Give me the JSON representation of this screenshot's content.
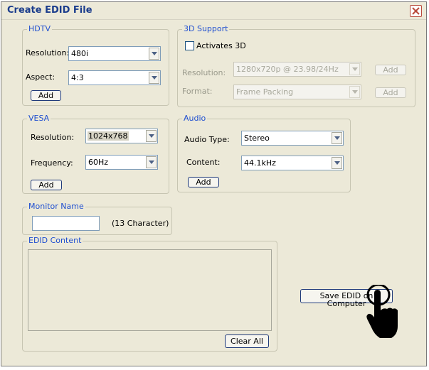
{
  "window": {
    "title": "Create EDID File"
  },
  "hdtv": {
    "legend": "HDTV",
    "resolution_label": "Resolution:",
    "resolution_value": "480i",
    "aspect_label": "Aspect:",
    "aspect_value": "4:3",
    "add_label": "Add"
  },
  "support3d": {
    "legend": "3D Support",
    "activate_label": "Activates 3D",
    "activate_checked": false,
    "resolution_label": "Resolution:",
    "resolution_value": "1280x720p @ 23.98/24Hz",
    "format_label": "Format:",
    "format_value": "Frame Packing",
    "add_label": "Add"
  },
  "vesa": {
    "legend": "VESA",
    "resolution_label": "Resolution:",
    "resolution_value": "1024x768",
    "frequency_label": "Frequency:",
    "frequency_value": "60Hz",
    "add_label": "Add"
  },
  "audio": {
    "legend": "Audio",
    "type_label": "Audio Type:",
    "type_value": "Stereo",
    "content_label": "Content:",
    "content_value": "44.1kHz",
    "add_label": "Add"
  },
  "monitor": {
    "legend": "Monitor Name",
    "value": "",
    "hint": "(13 Character)"
  },
  "edid": {
    "legend": "EDID Content",
    "value": "",
    "clear_label": "Clear All"
  },
  "save_label": "Save EDID on Computer",
  "icons": [
    "close-icon",
    "dropdown-arrow-icon",
    "scroll-up-icon",
    "scroll-down-icon",
    "hand-pointer-icon"
  ]
}
